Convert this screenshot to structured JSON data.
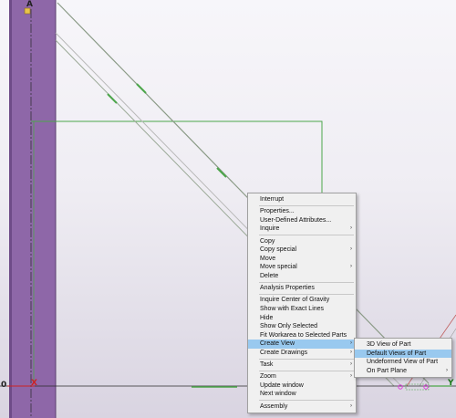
{
  "viewport": {
    "grid_label_a": "A",
    "grid_label_0": "0",
    "axis_x_marker": "X",
    "axis_y_label": "Y",
    "colors": {
      "column": "#8e67a8",
      "column_edge": "#5a3f6e",
      "green_line": "#4ca64a",
      "beam_line": "#8a9a86",
      "highlight": "#99c9ef",
      "axis_x": "#cc2222",
      "magenta_marker": "#e040e0"
    }
  },
  "context_menu": {
    "items": [
      {
        "label": "Interrupt",
        "submenu": false
      },
      {
        "separator": true
      },
      {
        "label": "Properties...",
        "submenu": false
      },
      {
        "label": "User-Defined Attributes...",
        "submenu": false
      },
      {
        "label": "Inquire",
        "submenu": true
      },
      {
        "separator": true
      },
      {
        "label": "Copy",
        "submenu": false
      },
      {
        "label": "Copy special",
        "submenu": true
      },
      {
        "label": "Move",
        "submenu": false
      },
      {
        "label": "Move special",
        "submenu": true
      },
      {
        "label": "Delete",
        "submenu": false
      },
      {
        "separator": true
      },
      {
        "label": "Analysis Properties",
        "submenu": false
      },
      {
        "separator": true
      },
      {
        "label": "Inquire Center of Gravity",
        "submenu": false
      },
      {
        "label": "Show with Exact Lines",
        "submenu": false
      },
      {
        "label": "Hide",
        "submenu": false
      },
      {
        "label": "Show Only Selected",
        "submenu": false
      },
      {
        "label": "Fit Workarea to Selected Parts",
        "submenu": false
      },
      {
        "label": "Create View",
        "submenu": true,
        "highlighted": true
      },
      {
        "label": "Create Drawings",
        "submenu": true
      },
      {
        "separator": true
      },
      {
        "label": "Task",
        "submenu": true
      },
      {
        "separator": true
      },
      {
        "label": "Zoom",
        "submenu": true
      },
      {
        "label": "Update window",
        "submenu": false
      },
      {
        "label": "Next window",
        "submenu": false
      },
      {
        "separator": true
      },
      {
        "label": "Assembly",
        "submenu": true
      }
    ]
  },
  "submenu": {
    "items": [
      {
        "label": "3D View of Part",
        "submenu": false
      },
      {
        "label": "Default Views of Part",
        "submenu": false,
        "highlighted": true
      },
      {
        "label": "Undeformed View of Part",
        "submenu": false
      },
      {
        "label": "On Part Plane",
        "submenu": true
      }
    ]
  },
  "arrow_glyph": "›"
}
